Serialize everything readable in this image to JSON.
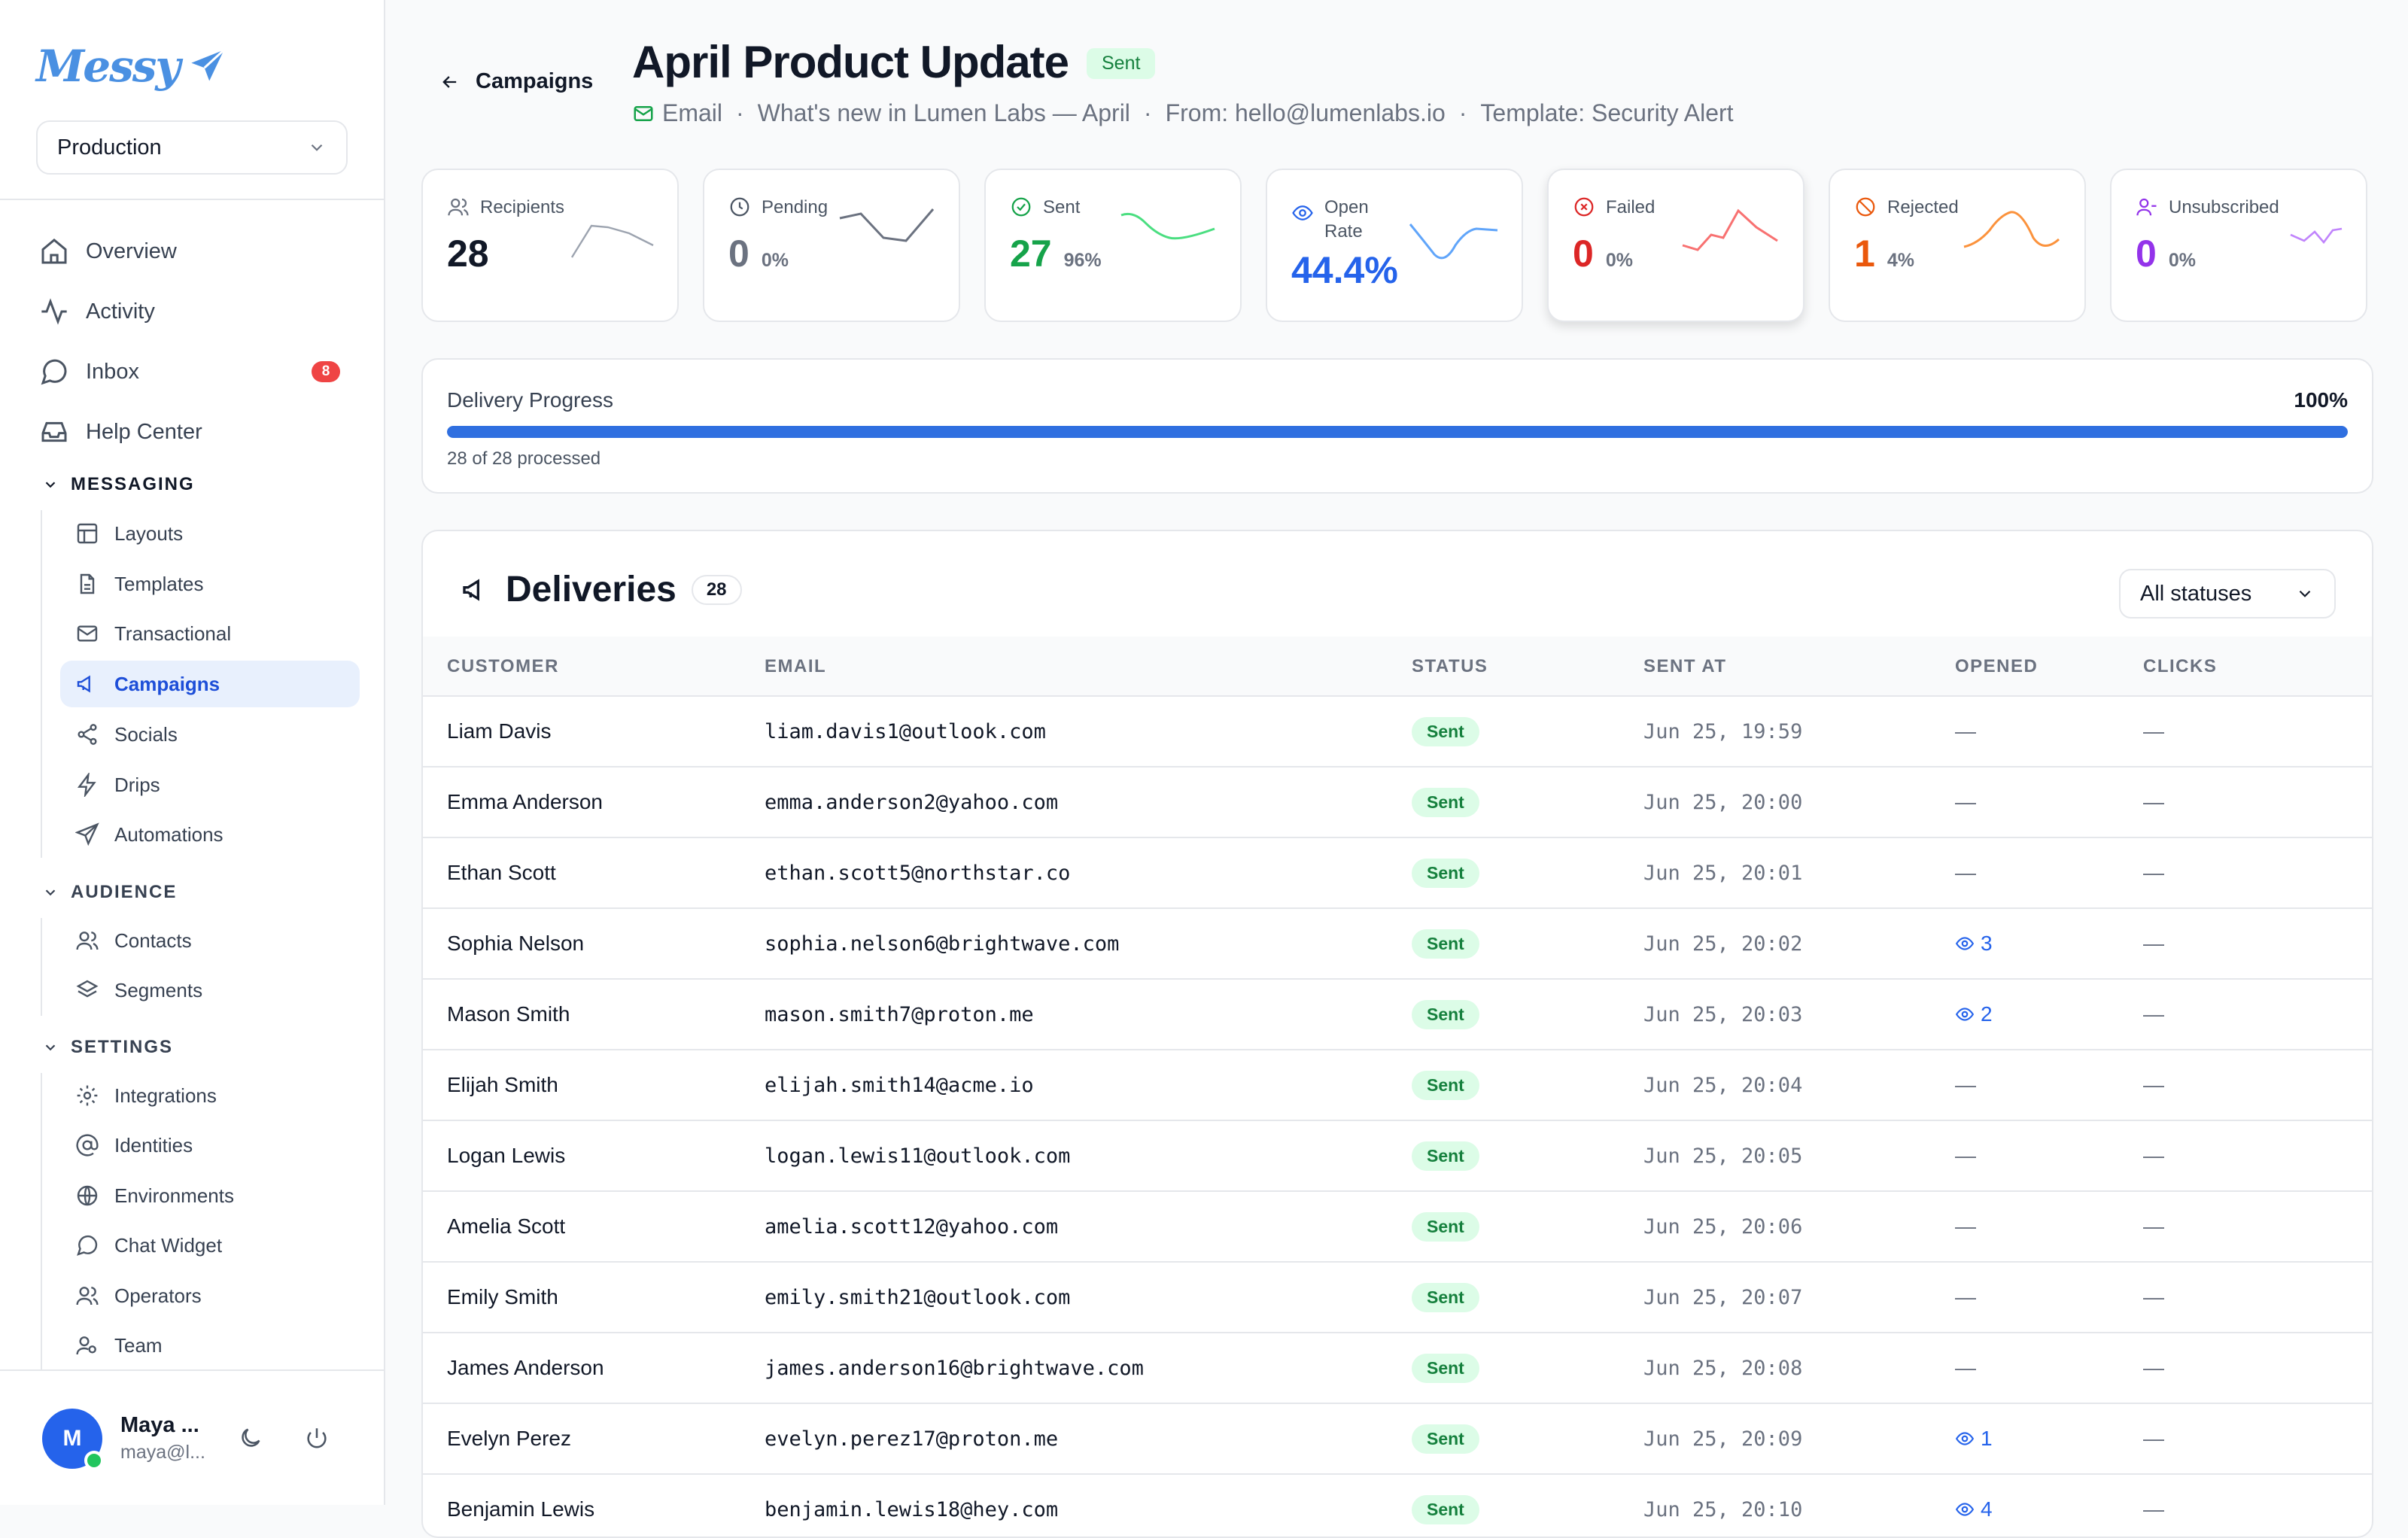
{
  "brand": {
    "name": "Messy"
  },
  "environment": {
    "selected": "Production"
  },
  "nav": {
    "overview": "Overview",
    "activity": "Activity",
    "inbox": "Inbox",
    "inbox_badge": "8",
    "help": "Help Center"
  },
  "sections": {
    "messaging": {
      "label": "MESSAGING",
      "items": [
        "Layouts",
        "Templates",
        "Transactional",
        "Campaigns",
        "Socials",
        "Drips",
        "Automations"
      ]
    },
    "audience": {
      "label": "AUDIENCE",
      "items": [
        "Contacts",
        "Segments"
      ]
    },
    "settings": {
      "label": "SETTINGS",
      "items": [
        "Integrations",
        "Identities",
        "Environments",
        "Chat Widget",
        "Operators",
        "Team"
      ]
    }
  },
  "user": {
    "initial": "M",
    "name": "Maya ...",
    "email": "maya@l..."
  },
  "header": {
    "back_label": "Campaigns",
    "title": "April Product Update",
    "status": "Sent",
    "channel": "Email",
    "subject": "What's new in Lumen Labs — April",
    "from": "From: hello@lumenlabs.io",
    "template": "Template: Security Alert",
    "sep": "·"
  },
  "stats": [
    {
      "label": "Recipients",
      "value": "28",
      "pct": "",
      "color": "#111827",
      "icon": "users-icon"
    },
    {
      "label": "Pending",
      "value": "0",
      "pct": "0%",
      "color": "#6b7280",
      "icon": "clock-icon"
    },
    {
      "label": "Sent",
      "value": "27",
      "pct": "96%",
      "color": "#16a34a",
      "icon": "check-circle-icon"
    },
    {
      "label": "Open",
      "label2": "Rate",
      "value": "44.4%",
      "pct": "",
      "color": "#2563eb",
      "icon": "eye-icon"
    },
    {
      "label": "Failed",
      "value": "0",
      "pct": "0%",
      "color": "#dc2626",
      "icon": "x-circle-icon"
    },
    {
      "label": "Rejected",
      "value": "1",
      "pct": "4%",
      "color": "#ea580c",
      "icon": "ban-icon"
    },
    {
      "label": "Unsubscribed",
      "value": "0",
      "pct": "0%",
      "color": "#9333ea",
      "icon": "user-minus-icon"
    }
  ],
  "progress": {
    "label": "Delivery Progress",
    "percent_text": "100%",
    "fraction": 1.0,
    "sub": "28 of 28 processed"
  },
  "deliveries": {
    "title": "Deliveries",
    "count": "28",
    "filter": "All statuses",
    "columns": [
      "CUSTOMER",
      "EMAIL",
      "STATUS",
      "SENT AT",
      "OPENED",
      "CLICKS"
    ],
    "rows": [
      {
        "customer": "Liam Davis",
        "email": "liam.davis1@outlook.com",
        "status": "Sent",
        "sent_at": "Jun 25, 19:59",
        "opened": "—",
        "clicks": "—"
      },
      {
        "customer": "Emma Anderson",
        "email": "emma.anderson2@yahoo.com",
        "status": "Sent",
        "sent_at": "Jun 25, 20:00",
        "opened": "—",
        "clicks": "—"
      },
      {
        "customer": "Ethan Scott",
        "email": "ethan.scott5@northstar.co",
        "status": "Sent",
        "sent_at": "Jun 25, 20:01",
        "opened": "—",
        "clicks": "—"
      },
      {
        "customer": "Sophia Nelson",
        "email": "sophia.nelson6@brightwave.com",
        "status": "Sent",
        "sent_at": "Jun 25, 20:02",
        "opened": "3",
        "clicks": "—"
      },
      {
        "customer": "Mason Smith",
        "email": "mason.smith7@proton.me",
        "status": "Sent",
        "sent_at": "Jun 25, 20:03",
        "opened": "2",
        "clicks": "—"
      },
      {
        "customer": "Elijah Smith",
        "email": "elijah.smith14@acme.io",
        "status": "Sent",
        "sent_at": "Jun 25, 20:04",
        "opened": "—",
        "clicks": "—"
      },
      {
        "customer": "Logan Lewis",
        "email": "logan.lewis11@outlook.com",
        "status": "Sent",
        "sent_at": "Jun 25, 20:05",
        "opened": "—",
        "clicks": "—"
      },
      {
        "customer": "Amelia Scott",
        "email": "amelia.scott12@yahoo.com",
        "status": "Sent",
        "sent_at": "Jun 25, 20:06",
        "opened": "—",
        "clicks": "—"
      },
      {
        "customer": "Emily Smith",
        "email": "emily.smith21@outlook.com",
        "status": "Sent",
        "sent_at": "Jun 25, 20:07",
        "opened": "—",
        "clicks": "—"
      },
      {
        "customer": "James Anderson",
        "email": "james.anderson16@brightwave.com",
        "status": "Sent",
        "sent_at": "Jun 25, 20:08",
        "opened": "—",
        "clicks": "—"
      },
      {
        "customer": "Evelyn Perez",
        "email": "evelyn.perez17@proton.me",
        "status": "Sent",
        "sent_at": "Jun 25, 20:09",
        "opened": "1",
        "clicks": "—"
      },
      {
        "customer": "Benjamin Lewis",
        "email": "benjamin.lewis18@hey.com",
        "status": "Sent",
        "sent_at": "Jun 25, 20:10",
        "opened": "4",
        "clicks": "—"
      }
    ]
  }
}
